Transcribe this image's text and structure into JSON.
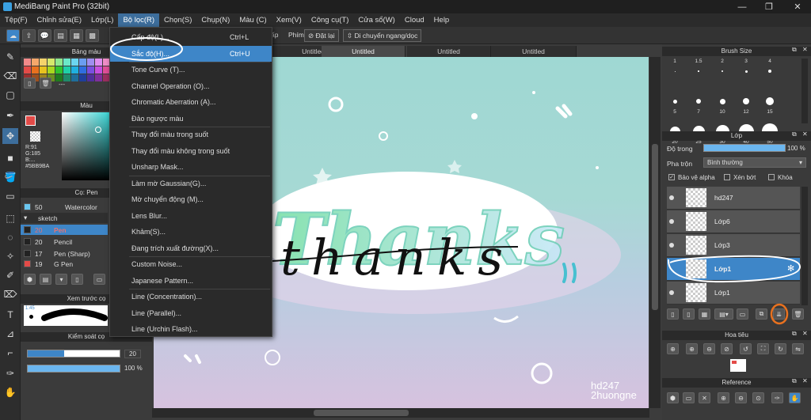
{
  "window": {
    "title": "MediBang Paint Pro (32bit)",
    "controls": [
      "—",
      "❐",
      "✕"
    ]
  },
  "menubar": [
    "Tệp(F)",
    "Chỉnh sửa(E)",
    "Lớp(L)",
    "Bộ lọc(R)",
    "Chọn(S)",
    "Chụp(N)",
    "Màu (C)",
    "Xem(V)",
    "Công cụ(T)",
    "Cửa sổ(W)",
    "Cloud",
    "Help"
  ],
  "toolbar": {
    "label_ap": "ấp",
    "label_phim": "Phím",
    "reset_label": "Đặt lại",
    "move_label": "Di chuyển ngang/dọc"
  },
  "tabs": [
    "Untitled",
    "Untitled",
    "Untitled",
    "Untitled"
  ],
  "filter_menu": {
    "items": [
      {
        "label": "Cấp độ(L)...",
        "shortcut": "Ctrl+L"
      },
      {
        "label": "Sắc độ(H)...",
        "shortcut": "Ctrl+U",
        "highlight": true
      },
      {
        "label": "Tone Curve (T)..."
      },
      {
        "label": "Channel Operation (O)..."
      },
      {
        "label": "Chromatic Aberration (A)..."
      },
      {
        "label": "Đảo ngược màu"
      },
      {
        "label": "Thay đổi màu trong suốt"
      },
      {
        "label": "Thay đổi màu không trong suốt"
      },
      {
        "label": "Unsharp Mask..."
      },
      {
        "label": "Làm mờ Gaussian(G)..."
      },
      {
        "label": "Mờ chuyển động (M)..."
      },
      {
        "label": "Lens Blur..."
      },
      {
        "label": "Khảm(S)..."
      },
      {
        "label": "Đang trích xuất đường(X)..."
      },
      {
        "label": "Custom Noise..."
      },
      {
        "label": "Japanese Pattern..."
      },
      {
        "label": "Line (Concentration)..."
      },
      {
        "label": "Line (Parallel)..."
      },
      {
        "label": "Line (Urchin Flash)..."
      }
    ]
  },
  "left_panel": {
    "palette_title": "Bảng màu",
    "palette_dash": "---",
    "color_title": "Màu",
    "rgb": {
      "r": "R:91",
      "g": "G:185",
      "b": "B:...",
      "hex": "#5BB9BA"
    },
    "brush_title": "Cọ: Pen",
    "brush_list": [
      {
        "num": "50",
        "name": "Watercolor"
      },
      {
        "num": "",
        "name": "sketch"
      },
      {
        "num": "20",
        "name": "Pen",
        "selected": true
      },
      {
        "num": "20",
        "name": "Pencil"
      },
      {
        "num": "17",
        "name": "Pen (Sharp)"
      },
      {
        "num": "19",
        "name": "G Pen"
      }
    ],
    "preview_title": "Xem trước cọ",
    "preview_size": "1:45",
    "control_title": "Kiểm soát cọ",
    "size_value": "20",
    "opacity_value": "100 %"
  },
  "canvas": {
    "watermark_line1": "hd247",
    "watermark_line2": "2huongne",
    "word_bg": "Thanks",
    "word_script": "thanks"
  },
  "right_panel": {
    "brush_size_title": "Brush Size",
    "sizes": [
      "1",
      "1.5",
      "2",
      "3",
      "4",
      "5",
      "7",
      "10",
      "12",
      "15",
      "20",
      "25",
      "30",
      "40",
      "50"
    ],
    "layer_title": "Lớp",
    "opacity_label": "Độ trong",
    "opacity_value": "100 %",
    "blend_label": "Pha trộn",
    "blend_value": "Bình thường",
    "protect_alpha": "Bảo vệ alpha",
    "clipping": "Xén bớt",
    "lock": "Khóa",
    "layers": [
      {
        "name": "hd247"
      },
      {
        "name": "Lớp6"
      },
      {
        "name": "Lớp3"
      },
      {
        "name": "Lớp1",
        "selected": true
      },
      {
        "name": "Lớp1"
      }
    ],
    "navigator_title": "Hoa tiêu",
    "reference_title": "Reference"
  },
  "colors": {
    "accent": "#3e86c8",
    "annotation_orange": "#e8711f",
    "canvas_teal": "#9fd8d3",
    "canvas_pink": "#d7c2df"
  }
}
